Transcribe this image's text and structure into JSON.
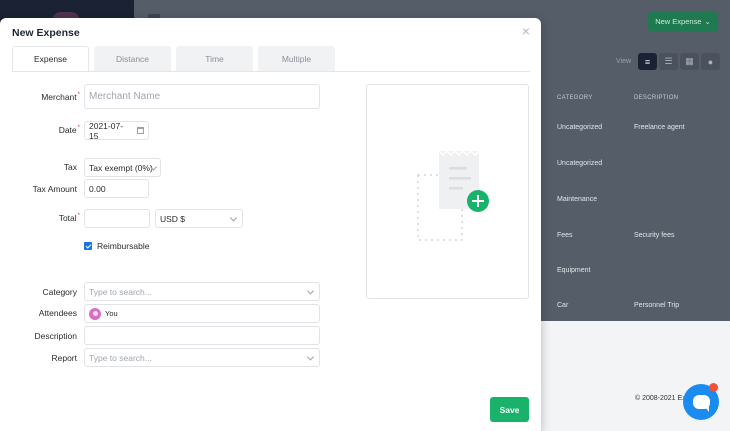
{
  "background": {
    "new_expense_label": "New Expense",
    "view_label": "View",
    "columns": [
      "CATEGORY",
      "DESCRIPTION"
    ],
    "rows": [
      {
        "category": "Uncategorized",
        "description": "Freelance agent"
      },
      {
        "category": "Uncategorized",
        "description": ""
      },
      {
        "category": "Maintenance",
        "description": ""
      },
      {
        "category": "Fees",
        "description": "Security fees"
      },
      {
        "category": "Equipment",
        "description": ""
      },
      {
        "category": "Car",
        "description": "Personnel Trip"
      }
    ],
    "copyright": "© 2008-2021 Ex"
  },
  "modal": {
    "title": "New Expense",
    "close": "×",
    "tabs": [
      {
        "label": "Expense",
        "active": true
      },
      {
        "label": "Distance",
        "active": false
      },
      {
        "label": "Time",
        "active": false
      },
      {
        "label": "Multiple",
        "active": false
      }
    ],
    "form": {
      "merchant": {
        "label": "Merchant",
        "placeholder": "Merchant Name",
        "value": ""
      },
      "date": {
        "label": "Date",
        "value": "2021-07-15"
      },
      "tax": {
        "label": "Tax",
        "value": "Tax exempt (0%)"
      },
      "tax_amount": {
        "label": "Tax Amount",
        "value": "0.00"
      },
      "total": {
        "label": "Total",
        "value": "",
        "currency": "USD $"
      },
      "reimbursable": {
        "label": "Reimbursable",
        "checked": true
      },
      "category": {
        "label": "Category",
        "placeholder": "Type to search..."
      },
      "attendees": {
        "label": "Attendees",
        "value": "You"
      },
      "description": {
        "label": "Description",
        "value": ""
      },
      "report": {
        "label": "Report",
        "placeholder": "Type to search..."
      }
    },
    "required_mark": "*",
    "save_label": "Save"
  },
  "colors": {
    "accent_green": "#18b26b",
    "checkbox_blue": "#1a73e8",
    "chat_blue": "#1a8cf0",
    "sidebar_dark": "#1a2233"
  }
}
